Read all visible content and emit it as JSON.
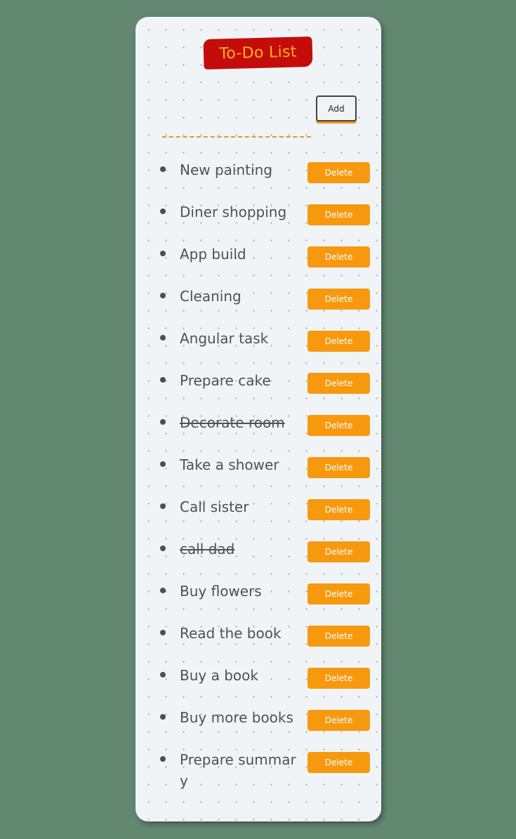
{
  "app": {
    "title": "To-Do List"
  },
  "form": {
    "input_value": "",
    "input_placeholder": "",
    "add_label": "Add"
  },
  "todos": [
    {
      "text": "New painting",
      "done": false,
      "delete_label": "Delete"
    },
    {
      "text": "Diner shopping",
      "done": false,
      "delete_label": "Delete"
    },
    {
      "text": "App build",
      "done": false,
      "delete_label": "Delete"
    },
    {
      "text": "Cleaning",
      "done": false,
      "delete_label": "Delete"
    },
    {
      "text": "Angular task",
      "done": false,
      "delete_label": "Delete"
    },
    {
      "text": "Prepare cake",
      "done": false,
      "delete_label": "Delete"
    },
    {
      "text": "Decorate room",
      "done": true,
      "delete_label": "Delete"
    },
    {
      "text": "Take a shower",
      "done": false,
      "delete_label": "Delete"
    },
    {
      "text": "Call sister",
      "done": false,
      "delete_label": "Delete"
    },
    {
      "text": "call dad",
      "done": true,
      "delete_label": "Delete"
    },
    {
      "text": "Buy flowers",
      "done": false,
      "delete_label": "Delete"
    },
    {
      "text": "Read the book",
      "done": false,
      "delete_label": "Delete"
    },
    {
      "text": "Buy a book",
      "done": false,
      "delete_label": "Delete"
    },
    {
      "text": "Buy more books",
      "done": false,
      "delete_label": "Delete"
    },
    {
      "text": "Prepare summary",
      "done": false,
      "delete_label": "Delete"
    }
  ],
  "colors": {
    "background": "#628872",
    "title_bg": "#c40d0a",
    "title_text": "#ffb21a",
    "accent": "#f7990f"
  }
}
